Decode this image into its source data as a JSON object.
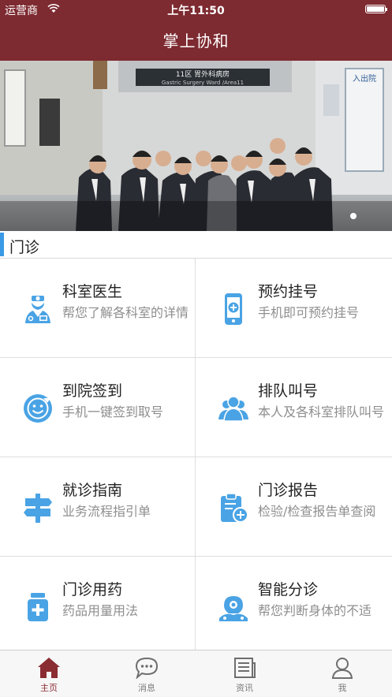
{
  "status_bar": {
    "carrier": "运营商",
    "time": "上午11:50"
  },
  "header": {
    "title": "掌上协和"
  },
  "banner": {
    "sign_text": "11区 胃外科病房",
    "sign_subtext": "Gastric Surgery Ward /Area11",
    "board_text": "入出院",
    "page_indicator": "1"
  },
  "section": {
    "title": "门诊"
  },
  "services": [
    {
      "title": "科室医生",
      "desc": "帮您了解各科室的详情",
      "icon": "doctor-icon"
    },
    {
      "title": "预约挂号",
      "desc": "手机即可预约挂号",
      "icon": "phone-plus-icon"
    },
    {
      "title": "到院签到",
      "desc": "手机一键签到取号",
      "icon": "check-in-icon"
    },
    {
      "title": "排队叫号",
      "desc": "本人及各科室排队叫号",
      "icon": "queue-people-icon"
    },
    {
      "title": "就诊指南",
      "desc": "业务流程指引单",
      "icon": "signpost-icon"
    },
    {
      "title": "门诊报告",
      "desc": "检验/检查报告单查阅",
      "icon": "clipboard-report-icon"
    },
    {
      "title": "门诊用药",
      "desc": "药品用量用法",
      "icon": "medicine-bottle-icon"
    },
    {
      "title": "智能分诊",
      "desc": "帮您判断身体的不适",
      "icon": "triage-icon"
    }
  ],
  "tabs": [
    {
      "label": "主页",
      "icon": "home-icon",
      "active": true
    },
    {
      "label": "消息",
      "icon": "chat-icon",
      "active": false
    },
    {
      "label": "资讯",
      "icon": "news-icon",
      "active": false
    },
    {
      "label": "我",
      "icon": "person-icon",
      "active": false
    }
  ],
  "colors": {
    "header": "#7d2a30",
    "accent": "#3a9ae6",
    "icon_blue": "#4aa3e4",
    "tab_active": "#8a2d33"
  }
}
